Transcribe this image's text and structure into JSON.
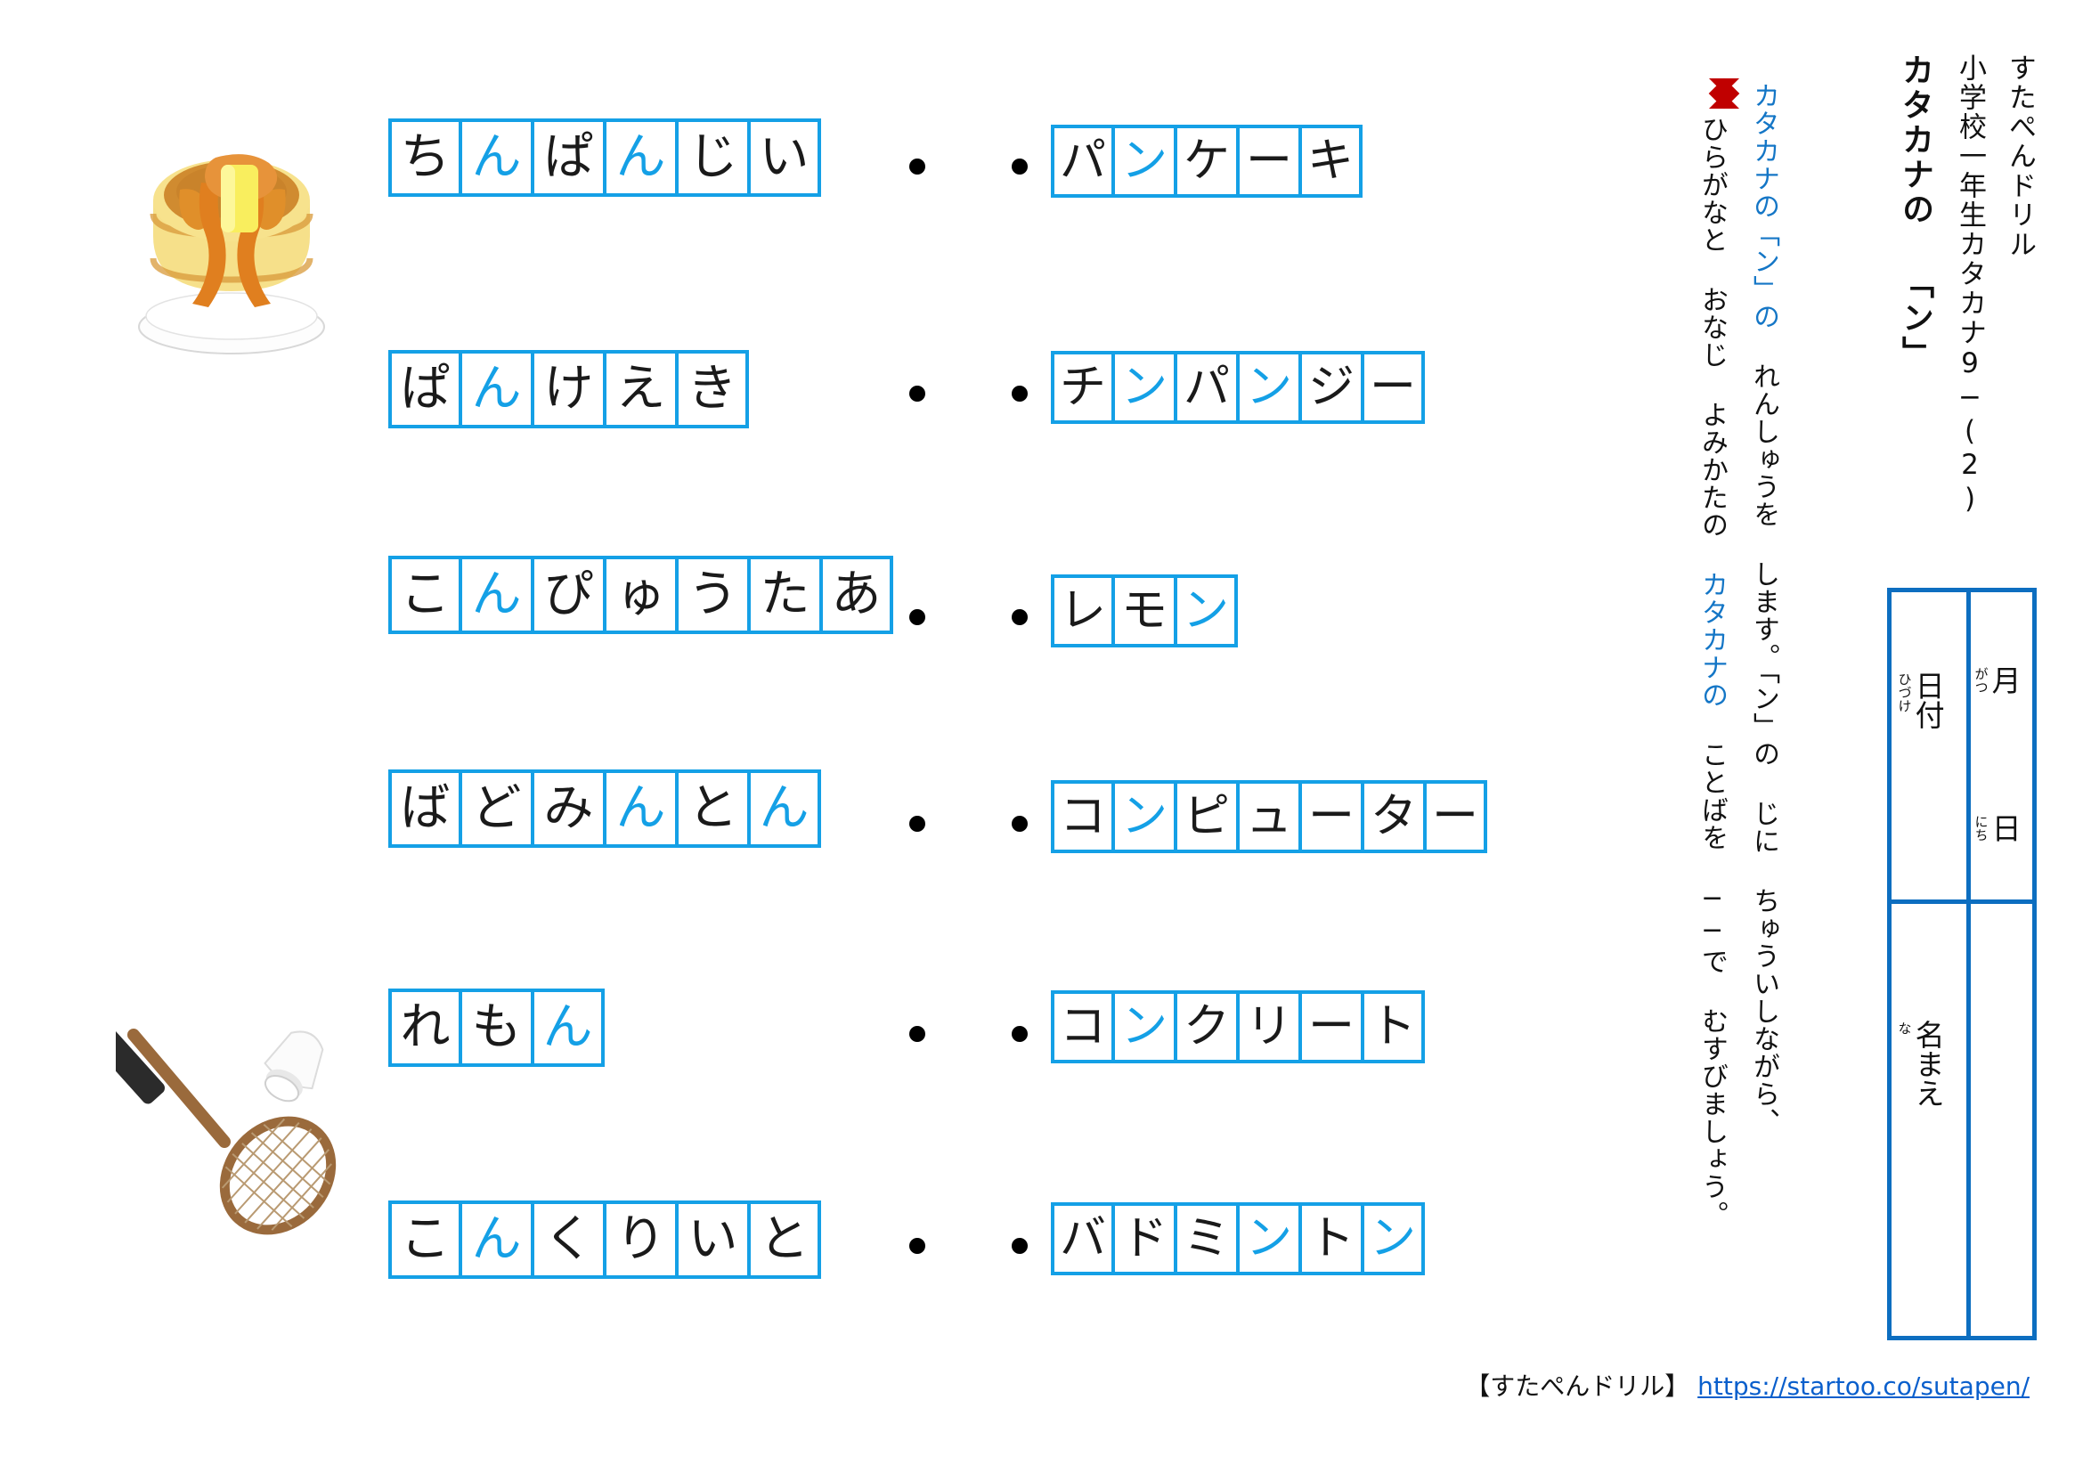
{
  "header": {
    "brand": "すたぺんドリル",
    "series": "小学校一年生カタカナ9−(2)",
    "title": "カタカナの 「ン」"
  },
  "instructions": {
    "marker": "◆",
    "line1_blue_a": "カタカナの",
    "line1_bracket": "「ン」の",
    "line1_rest": " れんしゅうを します。「ン」の じに ちゅういしながら、",
    "line2_a": "ひらがなと おなじ よみかたの ",
    "line2_blue": "カタカナの",
    "line2_rest": " ことばを ──で むすびましょう。"
  },
  "namebox": {
    "date_label": "日付",
    "date_ruby": "ひづけ",
    "month_label": "月",
    "month_ruby": "がつ",
    "day_label": "日",
    "day_ruby": "にち",
    "name_label": "名まえ",
    "name_ruby": "な"
  },
  "colors": {
    "grid_blue": "#14A0E6",
    "box_blue": "#0D6EC0",
    "highlight": "#14A0E6",
    "instruction_blue": "#1476c6",
    "marker_red": "#C00000",
    "link_blue": "#0a5fcc",
    "text_black": "#1a1a1a"
  },
  "hiragana_column": [
    {
      "word": "ちんぱんじい",
      "chars": [
        "ち",
        "ん",
        "ぱ",
        "ん",
        "じ",
        "い"
      ],
      "highlight_index": [
        1,
        3
      ]
    },
    {
      "word": "ぱんけえき",
      "chars": [
        "ぱ",
        "ん",
        "け",
        "え",
        "き"
      ],
      "highlight_index": [
        1
      ]
    },
    {
      "word": "こんぴゅうたあ",
      "chars": [
        "こ",
        "ん",
        "ぴ",
        "ゅ",
        "う",
        "た",
        "あ"
      ],
      "highlight_index": [
        1
      ]
    },
    {
      "word": "ばどみんとん",
      "chars": [
        "ば",
        "ど",
        "み",
        "ん",
        "と",
        "ん"
      ],
      "highlight_index": [
        3,
        5
      ]
    },
    {
      "word": "れもん",
      "chars": [
        "れ",
        "も",
        "ん"
      ],
      "highlight_index": [
        2
      ]
    },
    {
      "word": "こんくりいと",
      "chars": [
        "こ",
        "ん",
        "く",
        "り",
        "い",
        "と"
      ],
      "highlight_index": [
        1
      ]
    }
  ],
  "katakana_column": [
    {
      "word": "パンケーキ",
      "chars": [
        "パ",
        "ン",
        "ケ",
        "ー",
        "キ"
      ],
      "highlight_index": [
        1
      ]
    },
    {
      "word": "チンパンジー",
      "chars": [
        "チ",
        "ン",
        "パ",
        "ン",
        "ジ",
        "ー"
      ],
      "highlight_index": [
        1,
        3
      ]
    },
    {
      "word": "レモン",
      "chars": [
        "レ",
        "モ",
        "ン"
      ],
      "highlight_index": [
        2
      ]
    },
    {
      "word": "コンピューター",
      "chars": [
        "コ",
        "ン",
        "ピ",
        "ュ",
        "ー",
        "タ",
        "ー"
      ],
      "highlight_index": [
        1
      ]
    },
    {
      "word": "コンクリート",
      "chars": [
        "コ",
        "ン",
        "ク",
        "リ",
        "ー",
        "ト"
      ],
      "highlight_index": [
        1
      ]
    },
    {
      "word": "バドミントン",
      "chars": [
        "バ",
        "ド",
        "ミ",
        "ン",
        "ト",
        "ン"
      ],
      "highlight_index": [
        3,
        5
      ]
    }
  ],
  "illustrations": [
    {
      "name": "pancake-illustration"
    },
    {
      "name": "badminton-illustration"
    }
  ],
  "footer": {
    "label": "【すたぺんドリル】",
    "url": "https://startoo.co/sutapen/"
  }
}
